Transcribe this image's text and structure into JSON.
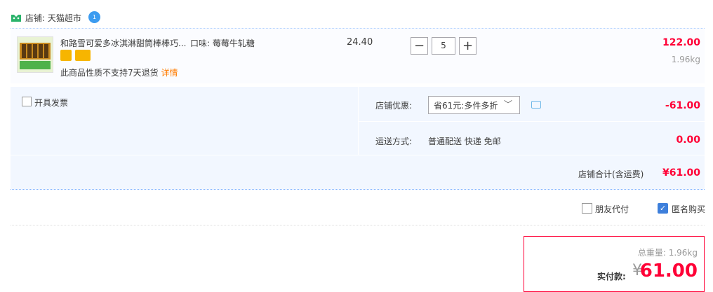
{
  "shop": {
    "label": "店铺: 天猫超市",
    "chat_badge": "1"
  },
  "item": {
    "title": "和路雪可爱多冰淇淋甜筒棒棒巧...",
    "attribute": "口味: 莓莓牛轧糖",
    "unit_price": "24.40",
    "quantity": "5",
    "subtotal": "122.00",
    "weight": "1.96kg",
    "no_return_text": "此商品性质不支持7天退货",
    "detail_link": "详情"
  },
  "options": {
    "invoice_label": "开具发票",
    "shop_discount_label": "店铺优惠:",
    "shop_discount_selected": "省61元:多件多折",
    "shop_discount_amount": "-61.00",
    "shipping_label": "运送方式:",
    "shipping_value": "普通配送 快递 免邮",
    "shipping_amount": "0.00",
    "shop_total_label": "店铺合计(含运费)",
    "shop_total_amount": "¥61.00"
  },
  "purchase": {
    "friend_pay_label": "朋友代付",
    "anonymous_label": "匿名购买",
    "anonymous_checked": true
  },
  "payment": {
    "total_weight": "总重量: 1.96kg",
    "pay_label": "实付款:",
    "currency": "¥",
    "amount": "61.00"
  },
  "colors": {
    "accent_red": "#ff0036",
    "accent_blue": "#3d7fdb",
    "link_orange": "#ff7b00"
  }
}
